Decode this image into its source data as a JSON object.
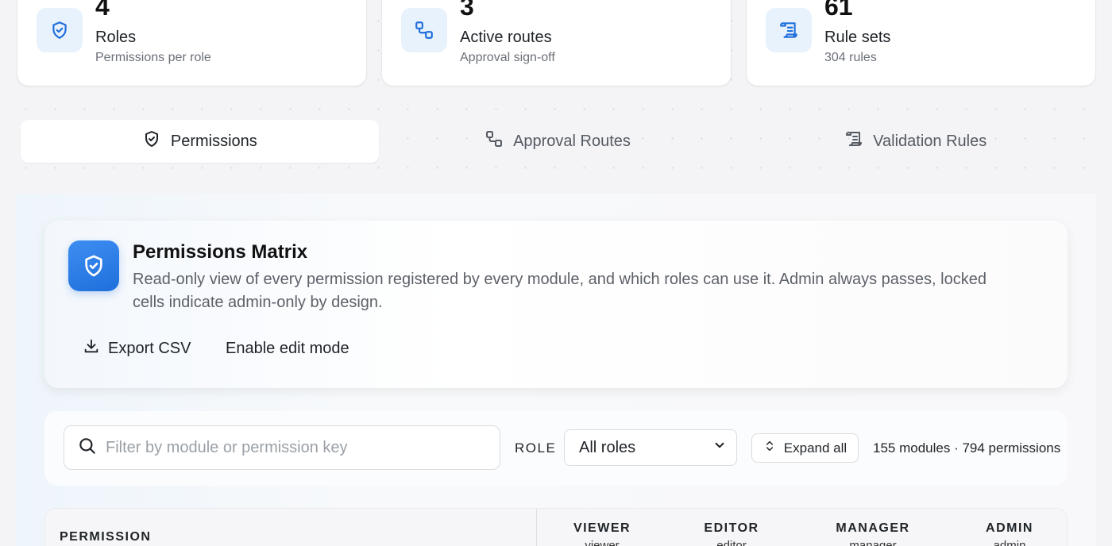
{
  "stats": [
    {
      "value": "4",
      "label": "Roles",
      "sub": "Permissions per role",
      "icon": "shield-icon"
    },
    {
      "value": "3",
      "label": "Active routes",
      "sub": "Approval sign-off",
      "icon": "route-icon"
    },
    {
      "value": "61",
      "label": "Rule sets",
      "sub": "304 rules",
      "icon": "scroll-icon"
    }
  ],
  "tabs": [
    {
      "label": "Permissions",
      "active": true
    },
    {
      "label": "Approval Routes",
      "active": false
    },
    {
      "label": "Validation Rules",
      "active": false
    }
  ],
  "hero": {
    "title": "Permissions Matrix",
    "description": "Read-only view of every permission registered by every module, and which roles can use it. Admin always passes, locked cells indicate admin-only by design.",
    "export_label": "Export CSV",
    "edit_label": "Enable edit mode"
  },
  "filters": {
    "search_placeholder": "Filter by module or permission key",
    "role_label": "ROLE",
    "role_selected": "All roles",
    "expand_label": "Expand all",
    "counts": "155 modules · 794 permissions"
  },
  "table": {
    "permission_header": "PERMISSION",
    "roles": [
      {
        "name": "VIEWER",
        "key": "viewer"
      },
      {
        "name": "EDITOR",
        "key": "editor"
      },
      {
        "name": "MANAGER",
        "key": "manager"
      },
      {
        "name": "ADMIN",
        "key": "admin"
      }
    ]
  },
  "colors": {
    "accent": "#1f6fdc",
    "icon_bg": "#e8f2fc"
  }
}
